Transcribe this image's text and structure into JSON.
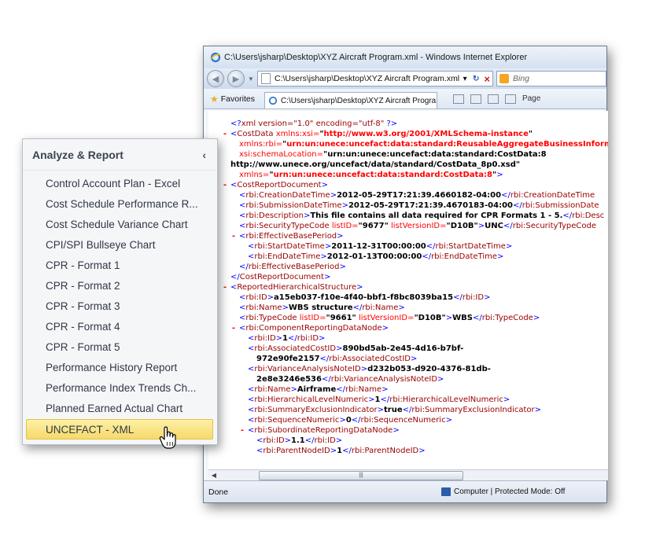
{
  "browser": {
    "window_title": "C:\\Users\\jsharp\\Desktop\\XYZ Aircraft Program.xml - Windows Internet Explorer",
    "address": "C:\\Users\\jsharp\\Desktop\\XYZ Aircraft Program.xml",
    "search_placeholder": "Bing",
    "favorites_label": "Favorites",
    "tab_label": "C:\\Users\\jsharp\\Desktop\\XYZ Aircraft Progra...",
    "page_menu": "Page",
    "status_text": "Done",
    "zone_text": "Computer | Protected Mode: Off"
  },
  "xml_lines": [
    {
      "indent": 0,
      "toggle": "",
      "html": "<span class='b'>&lt;?</span><span class='r'>xml version=\"1.0\" encoding=\"utf-8\"</span> <span class='b'>?&gt;</span>"
    },
    {
      "indent": 0,
      "toggle": "-",
      "html": "<span class='b'>&lt;</span><span class='r'>CostData</span> <span class='rr'>xmlns:xsi=</span><span class='k'>\"</span><span class='rb'>http://www.w3.org/2001/XMLSchema-instance</span><span class='k'>\"</span>"
    },
    {
      "indent": 1,
      "toggle": "",
      "html": "<span class='rr'>xmlns:rbi=</span><span class='k'>\"</span><span class='rb'>urn:un:unece:uncefact:data:standard:ReusableAggregateBusinessInform</span>"
    },
    {
      "indent": 1,
      "toggle": "",
      "html": "<span class='rr'>xsi:schemaLocation=</span><span class='k'>\"urn:un:unece:uncefact:data:standard:CostData:8</span>"
    },
    {
      "indent": 0,
      "toggle": "",
      "html": "<span class='k'>http://www.unece.org/uncefact/data/standard/CostData_8p0.xsd\"</span>"
    },
    {
      "indent": 1,
      "toggle": "",
      "html": "<span class='rr'>xmlns=</span><span class='k'>\"</span><span class='rb'>urn:un:unece:uncefact:data:standard:CostData:8</span><span class='k'>\"</span><span class='b'>&gt;</span>"
    },
    {
      "indent": 0,
      "toggle": "-",
      "html": "<span class='b'>&lt;</span><span class='r'>CostReportDocument</span><span class='b'>&gt;</span>"
    },
    {
      "indent": 1,
      "toggle": "",
      "html": "<span class='b'>&lt;</span><span class='r'>rbi:CreationDateTime</span><span class='b'>&gt;</span><span class='k'>2012-05-29T17:21:39.4660182-04:00</span><span class='b'>&lt;/</span><span class='r'>rbi:CreationDateTime</span>"
    },
    {
      "indent": 1,
      "toggle": "",
      "html": "<span class='b'>&lt;</span><span class='r'>rbi:SubmissionDateTime</span><span class='b'>&gt;</span><span class='k'>2012-05-29T17:21:39.4670183-04:00</span><span class='b'>&lt;/</span><span class='r'>rbi:SubmissionDate</span>"
    },
    {
      "indent": 1,
      "toggle": "",
      "html": "<span class='b'>&lt;</span><span class='r'>rbi:Description</span><span class='b'>&gt;</span><span class='k'>This file contains all data required for CPR Formats 1 - 5.</span><span class='b'>&lt;/</span><span class='r'>rbi:Desc</span>"
    },
    {
      "indent": 1,
      "toggle": "",
      "html": "<span class='b'>&lt;</span><span class='r'>rbi:SecurityTypeCode</span> <span class='rr'>listID=</span><span class='k'>\"9677\"</span> <span class='rr'>listVersionID=</span><span class='k'>\"D10B\"</span><span class='b'>&gt;</span><span class='k'>UNC</span><span class='b'>&lt;/</span><span class='r'>rbi:SecurityTypeCode</span>"
    },
    {
      "indent": 1,
      "toggle": "-",
      "html": "<span class='b'>&lt;</span><span class='r'>rbi:EffectiveBasePeriod</span><span class='b'>&gt;</span>"
    },
    {
      "indent": 2,
      "toggle": "",
      "html": "<span class='b'>&lt;</span><span class='r'>rbi:StartDateTime</span><span class='b'>&gt;</span><span class='k'>2011-12-31T00:00:00</span><span class='b'>&lt;/</span><span class='r'>rbi:StartDateTime</span><span class='b'>&gt;</span>"
    },
    {
      "indent": 2,
      "toggle": "",
      "html": "<span class='b'>&lt;</span><span class='r'>rbi:EndDateTime</span><span class='b'>&gt;</span><span class='k'>2012-01-13T00:00:00</span><span class='b'>&lt;/</span><span class='r'>rbi:EndDateTime</span><span class='b'>&gt;</span>"
    },
    {
      "indent": 1,
      "toggle": "",
      "html": "<span class='b'>&lt;/</span><span class='r'>rbi:EffectiveBasePeriod</span><span class='b'>&gt;</span>"
    },
    {
      "indent": 0,
      "toggle": "",
      "html": "<span class='b'>&lt;/</span><span class='r'>CostReportDocument</span><span class='b'>&gt;</span>"
    },
    {
      "indent": 0,
      "toggle": "-",
      "html": "<span class='b'>&lt;</span><span class='r'>ReportedHierarchicalStructure</span><span class='b'>&gt;</span>"
    },
    {
      "indent": 1,
      "toggle": "",
      "html": "<span class='b'>&lt;</span><span class='r'>rbi:ID</span><span class='b'>&gt;</span><span class='k'>a15eb037-f10e-4f40-bbf1-f8bc8039ba15</span><span class='b'>&lt;/</span><span class='r'>rbi:ID</span><span class='b'>&gt;</span>"
    },
    {
      "indent": 1,
      "toggle": "",
      "html": "<span class='b'>&lt;</span><span class='r'>rbi:Name</span><span class='b'>&gt;</span><span class='k'>WBS structure</span><span class='b'>&lt;/</span><span class='r'>rbi:Name</span><span class='b'>&gt;</span>"
    },
    {
      "indent": 1,
      "toggle": "",
      "html": "<span class='b'>&lt;</span><span class='r'>rbi:TypeCode</span> <span class='rr'>listID=</span><span class='k'>\"9661\"</span> <span class='rr'>listVersionID=</span><span class='k'>\"D10B\"</span><span class='b'>&gt;</span><span class='k'>WBS</span><span class='b'>&lt;/</span><span class='r'>rbi:TypeCode</span><span class='b'>&gt;</span>"
    },
    {
      "indent": 1,
      "toggle": "-",
      "html": "<span class='b'>&lt;</span><span class='r'>rbi:ComponentReportingDataNode</span><span class='b'>&gt;</span>"
    },
    {
      "indent": 2,
      "toggle": "",
      "html": "<span class='b'>&lt;</span><span class='r'>rbi:ID</span><span class='b'>&gt;</span><span class='k'>1</span><span class='b'>&lt;/</span><span class='r'>rbi:ID</span><span class='b'>&gt;</span>"
    },
    {
      "indent": 2,
      "toggle": "",
      "html": "<span class='b'>&lt;</span><span class='r'>rbi:AssociatedCostID</span><span class='b'>&gt;</span><span class='k'>890bd5ab-2e45-4d16-b7bf-</span>"
    },
    {
      "indent": 3,
      "toggle": "",
      "html": "<span class='k'>972e90fe2157</span><span class='b'>&lt;/</span><span class='r'>rbi:AssociatedCostID</span><span class='b'>&gt;</span>"
    },
    {
      "indent": 2,
      "toggle": "",
      "html": "<span class='b'>&lt;</span><span class='r'>rbi:VarianceAnalysisNoteID</span><span class='b'>&gt;</span><span class='k'>d232b053-d920-4376-81db-</span>"
    },
    {
      "indent": 3,
      "toggle": "",
      "html": "<span class='k'>2e8e3246e536</span><span class='b'>&lt;/</span><span class='r'>rbi:VarianceAnalysisNoteID</span><span class='b'>&gt;</span>"
    },
    {
      "indent": 2,
      "toggle": "",
      "html": "<span class='b'>&lt;</span><span class='r'>rbi:Name</span><span class='b'>&gt;</span><span class='k'>Airframe</span><span class='b'>&lt;/</span><span class='r'>rbi:Name</span><span class='b'>&gt;</span>"
    },
    {
      "indent": 2,
      "toggle": "",
      "html": "<span class='b'>&lt;</span><span class='r'>rbi:HierarchicalLevelNumeric</span><span class='b'>&gt;</span><span class='k'>1</span><span class='b'>&lt;/</span><span class='r'>rbi:HierarchicalLevelNumeric</span><span class='b'>&gt;</span>"
    },
    {
      "indent": 2,
      "toggle": "",
      "html": "<span class='b'>&lt;</span><span class='r'>rbi:SummaryExclusionIndicator</span><span class='b'>&gt;</span><span class='k'>true</span><span class='b'>&lt;/</span><span class='r'>rbi:SummaryExclusionIndicator</span><span class='b'>&gt;</span>"
    },
    {
      "indent": 2,
      "toggle": "",
      "html": "<span class='b'>&lt;</span><span class='r'>rbi:SequenceNumeric</span><span class='b'>&gt;</span><span class='k'>0</span><span class='b'>&lt;/</span><span class='r'>rbi:SequenceNumeric</span><span class='b'>&gt;</span>"
    },
    {
      "indent": 2,
      "toggle": "-",
      "html": "<span class='b'>&lt;</span><span class='r'>rbi:SubordinateReportingDataNode</span><span class='b'>&gt;</span>"
    },
    {
      "indent": 3,
      "toggle": "",
      "html": "<span class='b'>&lt;</span><span class='r'>rbi:ID</span><span class='b'>&gt;</span><span class='k'>1.1</span><span class='b'>&lt;/</span><span class='r'>rbi:ID</span><span class='b'>&gt;</span>"
    },
    {
      "indent": 3,
      "toggle": "",
      "html": "<span class='b'>&lt;</span><span class='r'>rbi:ParentNodeID</span><span class='b'>&gt;</span><span class='k'>1</span><span class='b'>&lt;/</span><span class='r'>rbi:ParentNodeID</span><span class='b'>&gt;</span>"
    }
  ],
  "panel": {
    "title": "Analyze & Report",
    "items": [
      "Control Account Plan - Excel",
      "Cost Schedule Performance R...",
      "Cost Schedule Variance Chart",
      "CPI/SPI Bullseye Chart",
      "CPR - Format 1",
      "CPR - Format 2",
      "CPR - Format 3",
      "CPR - Format 4",
      "CPR - Format 5",
      "Performance History Report",
      "Performance Index Trends Ch...",
      "Planned Earned Actual Chart"
    ],
    "selected_item": "UNCEFACT - XML"
  }
}
